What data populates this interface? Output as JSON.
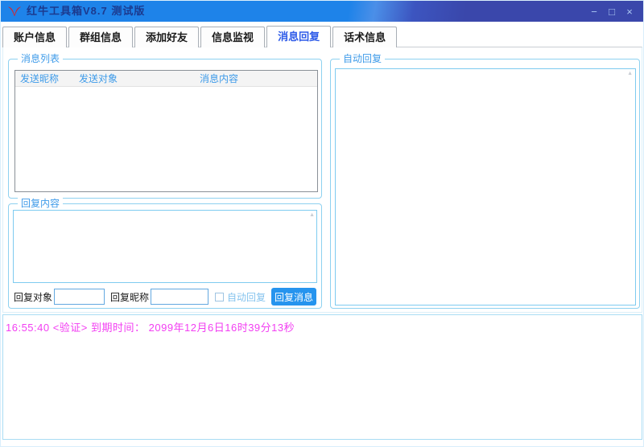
{
  "window": {
    "title": "红牛工具箱V8.7 测试版",
    "controls": {
      "minimize": "−",
      "maximize": "□",
      "close": "×"
    }
  },
  "tabs": [
    {
      "label": "账户信息",
      "active": false
    },
    {
      "label": "群组信息",
      "active": false
    },
    {
      "label": "添加好友",
      "active": false
    },
    {
      "label": "信息监视",
      "active": false
    },
    {
      "label": "消息回复",
      "active": true
    },
    {
      "label": "话术信息",
      "active": false
    }
  ],
  "message_list": {
    "group_label": "消息列表",
    "columns": [
      "发送昵称",
      "发送对象",
      "消息内容"
    ],
    "rows": []
  },
  "reply_panel": {
    "group_label": "回复内容",
    "content_value": "",
    "target_label": "回复对象",
    "target_value": "",
    "nickname_label": "回复昵称",
    "nickname_value": "",
    "autoreply_label": "自动回复",
    "autoreply_checked": false,
    "send_button_label": "回复消息"
  },
  "auto_reply_panel": {
    "group_label": "自动回复",
    "content_value": ""
  },
  "status_bar": {
    "text": "16:55:40 <验证> 到期时间： 2099年12月6日16时39分13秒"
  },
  "icons": {
    "scroll_up": "▲"
  },
  "colors": {
    "titlebar_left": "#1e83e9",
    "titlebar_right": "#3a47ab",
    "title_text": "#1c3a8e",
    "logo_red": "#e02020",
    "active_tab_text": "#2e5be8",
    "group_border": "#8ed1f0",
    "group_label_text": "#3e9be9",
    "button_bg": "#2694ee",
    "status_text": "#f23ff2"
  }
}
